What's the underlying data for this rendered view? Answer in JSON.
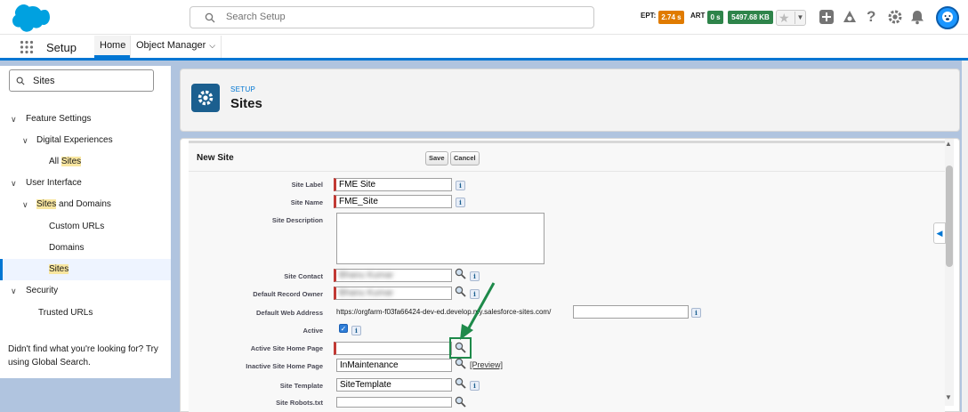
{
  "header": {
    "search_placeholder": "Search Setup",
    "ept_label": "EPT:",
    "ept_value": "2.74 s",
    "art_label": "ART",
    "art_value": "0 s",
    "memory_value": "5497.68 KB",
    "icons": [
      "salesforce-cloud-logo",
      "search-icon",
      "star-icon",
      "chevron-down-icon",
      "plus-icon",
      "trailhead-icon",
      "help-icon",
      "gear-icon",
      "bell-icon",
      "avatar"
    ],
    "colors": {
      "ept_badge": "#e07b00",
      "art_badge": "#2e844a",
      "memory_badge": "#2e844a",
      "brand": "#0176d3"
    }
  },
  "nav": {
    "app_name": "Setup",
    "tabs": [
      {
        "label": "Home",
        "active": true
      },
      {
        "label": "Object Manager",
        "has_dropdown": true
      }
    ]
  },
  "sidebar": {
    "search_value": "Sites",
    "tree": [
      {
        "label": "Feature Settings",
        "level": 0,
        "expanded": true
      },
      {
        "label": "Digital Experiences",
        "level": 1,
        "expanded": true
      },
      {
        "pre": "All ",
        "hl": "Sites",
        "level": 2
      },
      {
        "label": "User Interface",
        "level": 0,
        "expanded": true
      },
      {
        "pre": "",
        "hl": "Sites",
        "post": " and Domains",
        "level": 1,
        "expanded": true
      },
      {
        "label": "Custom URLs",
        "level": 2
      },
      {
        "label": "Domains",
        "level": 2
      },
      {
        "pre": "",
        "hl": "Sites",
        "level": 2,
        "selected": true
      },
      {
        "label": "Security",
        "level": 0,
        "expanded": true
      },
      {
        "label": "Trusted URLs",
        "level": 1
      }
    ],
    "help_text": "Didn't find what you're looking for? Try using Global Search."
  },
  "page_header": {
    "eyebrow": "SETUP",
    "title": "Sites"
  },
  "form": {
    "title": "New Site",
    "save_label": "Save",
    "cancel_label": "Cancel",
    "site_label": {
      "label": "Site Label",
      "value": "FME Site"
    },
    "site_name": {
      "label": "Site Name",
      "value": "FME_Site"
    },
    "site_description": {
      "label": "Site Description",
      "value": ""
    },
    "site_contact": {
      "label": "Site Contact",
      "value": "Bhanu Kumar"
    },
    "default_record_owner": {
      "label": "Default Record Owner",
      "value": "Bhanu Kumar"
    },
    "default_web_address": {
      "label": "Default Web Address",
      "value": "https://orgfarm-f03fa66424-dev-ed.develop.my.salesforce-sites.com/"
    },
    "active": {
      "label": "Active",
      "checked": true
    },
    "active_site_home_page": {
      "label": "Active Site Home Page",
      "value": ""
    },
    "inactive_site_home_page": {
      "label": "Inactive Site Home Page",
      "value": "InMaintenance",
      "preview_label": "[Preview]"
    },
    "site_template": {
      "label": "Site Template",
      "value": "SiteTemplate"
    },
    "site_robots": {
      "label": "Site Robots.txt",
      "value": ""
    }
  }
}
